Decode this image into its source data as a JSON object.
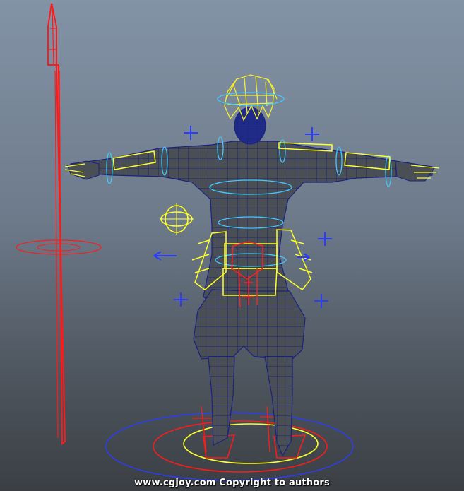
{
  "viewport": {
    "background_top": "#8393a6",
    "background_bottom": "#3b3f44"
  },
  "rig": {
    "mesh_fill": "#4a4e55",
    "wire_color": "#1a237e",
    "hair_color": "#f7ee2f",
    "armor_color": "#ffff2a",
    "spine_ctrl_color": "#41c8ff",
    "locator_color": "#2a3cff",
    "weapon_color": "#ff1a1a",
    "icons": [
      "four-arrow-locator-icon",
      "orbit-control-icon",
      "direction-arrow-icon"
    ]
  },
  "watermark": {
    "text": "www.cgjoy.com  Copyright to authors"
  }
}
